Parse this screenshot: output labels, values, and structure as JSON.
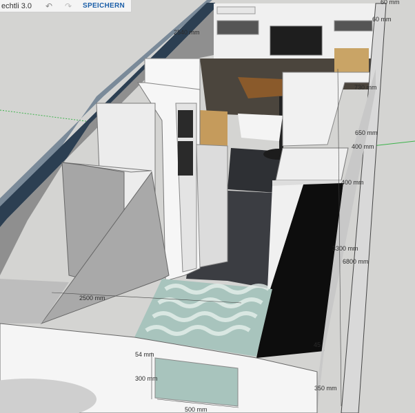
{
  "app": {
    "title": "echtli 3.0",
    "undo_icon": "undo-icon",
    "redo_icon": "redo-icon",
    "save_label": "SPEICHERN"
  },
  "dimensions": [
    {
      "id": "d1",
      "text": "60 mm"
    },
    {
      "id": "d2",
      "text": "60 mm"
    },
    {
      "id": "d3",
      "text": "2540 mm"
    },
    {
      "id": "d4",
      "text": "730 mm"
    },
    {
      "id": "d5",
      "text": "650 mm"
    },
    {
      "id": "d6",
      "text": "400 mm"
    },
    {
      "id": "d7",
      "text": "400 mm"
    },
    {
      "id": "d8",
      "text": "3300 mm"
    },
    {
      "id": "d9",
      "text": "6800 mm"
    },
    {
      "id": "d10",
      "text": "2500 mm"
    },
    {
      "id": "d11",
      "text": "54 mm"
    },
    {
      "id": "d12",
      "text": "300 mm"
    },
    {
      "id": "d13",
      "text": "500 mm"
    },
    {
      "id": "d14",
      "text": "350 mm"
    },
    {
      "id": "d15",
      "text": "45"
    }
  ],
  "colors": {
    "wall_light": "#f2f2f2",
    "wall_grey": "#a9a9a9",
    "floor_dark": "#3b3d42",
    "edge_blue": "#3c5a77",
    "wood": "#8a5a2b",
    "tile": "#a8c4bd"
  }
}
